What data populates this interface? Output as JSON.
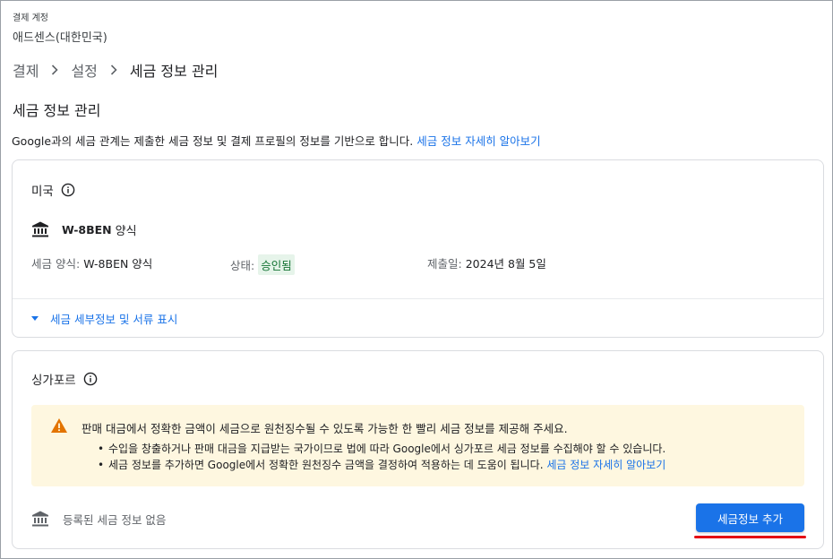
{
  "account": {
    "label": "결제 계정",
    "name": "애드센스(대한민국)"
  },
  "breadcrumb": [
    "결제",
    "설정",
    "세금 정보 관리"
  ],
  "page": {
    "title": "세금 정보 관리",
    "intro": "Google과의 세금 관계는 제출한 세금 정보 및 결제 프로필의 정보를 기반으로 합니다.",
    "intro_link": "세금 정보 자세히 알아보기"
  },
  "us": {
    "title": "미국",
    "form_name": "W-8BEN",
    "form_suffix": "양식",
    "type_label": "세금 양식:",
    "type_value": "W-8BEN 양식",
    "status_label": "상태:",
    "status_value": "승인됨",
    "date_label": "제출일:",
    "date_value": "2024년 8월 5일",
    "expand_label": "세금 세부정보 및 서류 표시"
  },
  "sg": {
    "title": "싱가포르",
    "warning_text": "판매 대금에서 정확한 금액이 세금으로 원천징수될 수 있도록 가능한 한 빨리 세금 정보를 제공해 주세요.",
    "bullet_1": "수입을 창출하거나 판매 대금을 지급받는 국가이므로 법에 따라 Google에서 싱가포르 세금 정보를 수집해야 할 수 있습니다.",
    "bullet_2": "세금 정보를 추가하면 Google에서 정확한 원천징수 금액을 결정하여 적용하는 데 도움이 됩니다.",
    "bullet_2_link": "세금 정보 자세히 알아보기",
    "empty_text": "등록된 세금 정보 없음",
    "add_button": "세금정보 추가"
  },
  "colors": {
    "accent": "#1a73e8",
    "status_bg": "#e6f4ea",
    "status_text": "#137333",
    "warning_bg": "#fef7e0",
    "warning_icon": "#e37400",
    "highlight_underline": "#e50914"
  },
  "icons": {
    "breadcrumb_separator": "chevron-right-icon",
    "info": "info-icon",
    "bank": "bank-icon",
    "warning": "warning-icon",
    "expand": "caret-down-icon"
  }
}
